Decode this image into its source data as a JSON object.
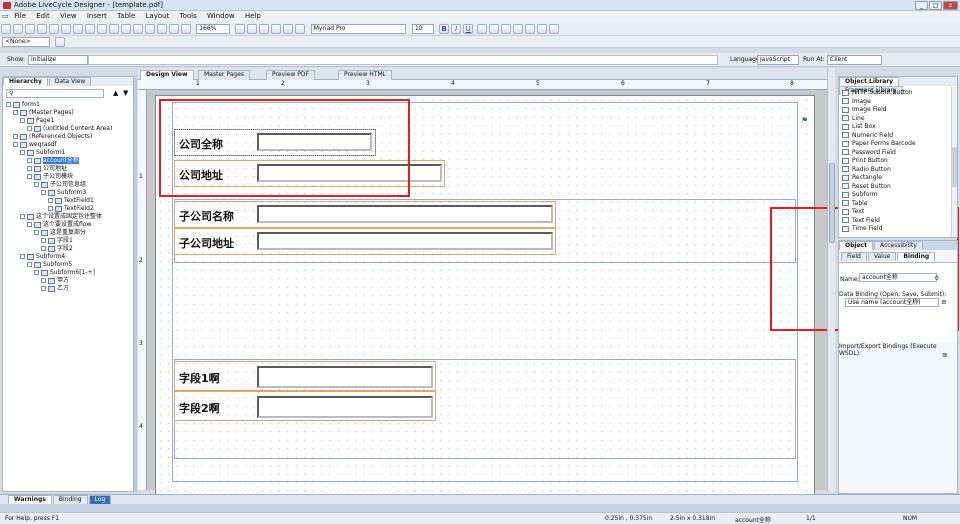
{
  "app": {
    "title": "Adobe LiveCycle Designer - [template.pdf]"
  },
  "window_controls": {
    "min": "_",
    "max": "□",
    "close": "x"
  },
  "menu": [
    "File",
    "Edit",
    "View",
    "Insert",
    "Table",
    "Layout",
    "Tools",
    "Window",
    "Help"
  ],
  "toolbar": {
    "zoom": "166%",
    "font": "Myriad Pro",
    "font_size": "10",
    "bold": "B",
    "italic": "I",
    "underline": "U"
  },
  "toolbar2": {
    "none_combo": "<None>"
  },
  "script_bar": {
    "show_label": "Show:",
    "show_value": "initialize",
    "language_label": "Language:",
    "language_value": "JavaScript",
    "runat_label": "Run At:",
    "runat_value": "Client"
  },
  "left_panel": {
    "tabs": [
      "Hierarchy",
      "Data View"
    ],
    "tree": [
      {
        "label": "form1",
        "indent": 0
      },
      {
        "label": "(Master Pages)",
        "indent": 1
      },
      {
        "label": "Page1",
        "indent": 2
      },
      {
        "label": "(untitled Content Area)",
        "indent": 3
      },
      {
        "label": "(Referenced Objects)",
        "indent": 1
      },
      {
        "label": "weqrasdf",
        "indent": 1
      },
      {
        "label": "Subform1",
        "indent": 2
      },
      {
        "label": "account全称",
        "indent": 3,
        "selected": true
      },
      {
        "label": "公司地址",
        "indent": 3
      },
      {
        "label": "子公司模块",
        "indent": 3
      },
      {
        "label": "子公司信息组",
        "indent": 4
      },
      {
        "label": "Subform3",
        "indent": 5
      },
      {
        "label": "TextField1",
        "indent": 6
      },
      {
        "label": "TextField2",
        "indent": 6
      },
      {
        "label": "这个设置成固定包住整体",
        "indent": 2
      },
      {
        "label": "这个要设置成flow",
        "indent": 3
      },
      {
        "label": "这是重复部分",
        "indent": 4
      },
      {
        "label": "字段1",
        "indent": 5
      },
      {
        "label": "字段2",
        "indent": 5
      },
      {
        "label": "Subform4",
        "indent": 2
      },
      {
        "label": "Subform5",
        "indent": 3
      },
      {
        "label": "Subform6[1-+]",
        "indent": 4
      },
      {
        "label": "甲方",
        "indent": 5
      },
      {
        "label": "乙方",
        "indent": 5
      }
    ]
  },
  "doc_tabs": [
    "Design View",
    "Master Pages",
    "Preview PDF",
    "Preview HTML"
  ],
  "ruler": {
    "numbers": [
      "1",
      "2",
      "3",
      "4",
      "5",
      "6",
      "7",
      "8"
    ],
    "vnumbers": [
      "1",
      "2",
      "3",
      "4"
    ]
  },
  "canvas": {
    "field_company_name": "公司全称",
    "field_company_addr": "公司地址",
    "field_sub_name": "子公司名称",
    "field_sub_addr": "子公司地址",
    "field_f1": "字段1啊",
    "field_f2": "字段2啊"
  },
  "object_library": {
    "tabs": [
      "Object Library",
      "Fragment Library"
    ],
    "items": [
      "HTTP Submit Button",
      "Image",
      "Image Field",
      "Line",
      "List Box",
      "Numeric Field",
      "Paper Forms Barcode",
      "Password Field",
      "Print Button",
      "Radio Button",
      "Rectangle",
      "Reset Button",
      "Subform",
      "Table",
      "Text",
      "Text Field",
      "Time Field"
    ]
  },
  "object_panel": {
    "tabs": [
      "Object",
      "Accessibility"
    ],
    "subtabs": [
      "Field",
      "Value",
      "Binding"
    ],
    "name_label": "Name:",
    "name_value": "account全称",
    "name_count": "0",
    "binding_label": "Data Binding (Open, Save, Submit):",
    "binding_value": "Use name (account全称)",
    "import_label": "Import/Export Bindings (Execute WSDL):"
  },
  "bottom_tabs": [
    "Warnings",
    "Binding",
    "Log"
  ],
  "status": {
    "help": "For Help, press F1",
    "pos": "0.25in , 0.375in",
    "size": "2.5in x 0.318in",
    "field": "account全称",
    "page": "1/1",
    "num": "NUM"
  },
  "colors": {
    "highlight_red": "#e41e1e",
    "field_border": "#e1a76a",
    "selection": "#3a78d6"
  }
}
